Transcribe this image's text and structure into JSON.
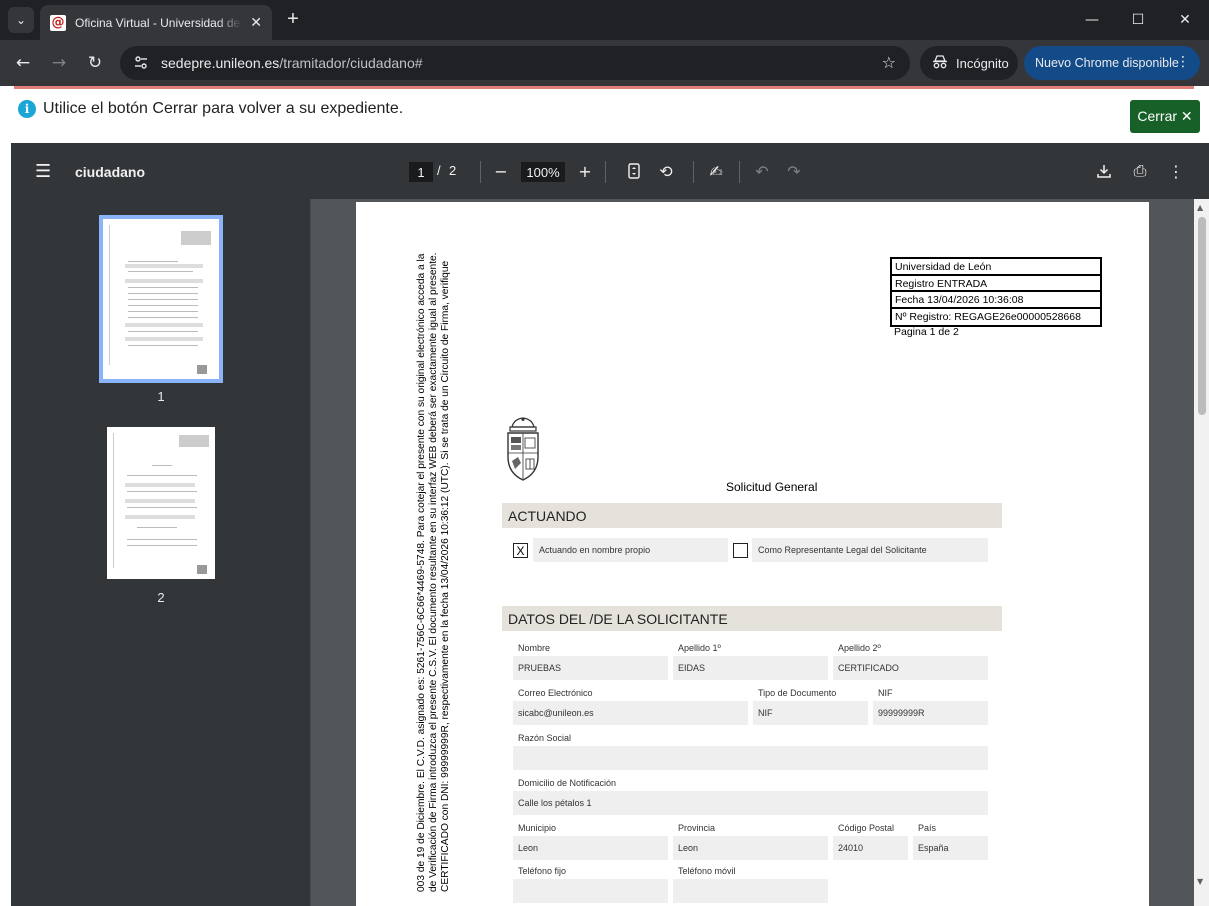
{
  "browser": {
    "tab_title": "Oficina Virtual - Universidad de León",
    "url_domain": "sedepre.unileon.es",
    "url_path": "/tramitador/ciudadano#",
    "incognito_label": "Incógnito",
    "update_label": "Nuevo Chrome disponible"
  },
  "page": {
    "info_message": "Utilice el botón Cerrar para volver a su expediente.",
    "close_button": "Cerrar ✕"
  },
  "viewer": {
    "doc_name": "ciudadano",
    "current_page": "1",
    "page_separator": "/",
    "total_pages": "2",
    "zoom": "100%",
    "thumbnails": [
      {
        "label": "1"
      },
      {
        "label": "2"
      }
    ]
  },
  "pdf": {
    "vertical_text": [
      "Para cotejar el presente con su original electrónico acceda a la",
      "de Verificación de Firma introduzca el presente C.S.V. El documento resultante en su interfaz WEB deberá ser exactamente igual al presente.",
      "CERTIFICADO con DNI: 99999999R, respectivamente en la fecha 13/04/2026 10:36:12 (UTC). Si se trata de un Circuito de Firma, verifique"
    ],
    "vertical_text_lead": "003 de 19 de Diciembre. El C.V.D. asignado es: 5261-756C-6C66*4469-5748. ",
    "registro": {
      "line1": "Universidad de León",
      "line2": "Registro ENTRADA",
      "line3": "Fecha 13/04/2026 10:36:08",
      "line4": "Nº Registro: REGAGE26e00000528668"
    },
    "pagina": "Pagina 1 de 2",
    "form_title": "Solicitud General",
    "section_actuando": "ACTUANDO",
    "opt1_mark": "X",
    "opt1": "Actuando en nombre propio",
    "opt2": "Como Representante Legal del Solicitante",
    "section_datos": "DATOS DEL /DE LA SOLICITANTE",
    "fields": {
      "nombre_label": "Nombre",
      "nombre": "PRUEBAS",
      "ap1_label": "Apellido 1º",
      "ap1": "EIDAS",
      "ap2_label": "Apellido 2º",
      "ap2": "CERTIFICADO",
      "email_label": "Correo Electrónico",
      "email": "sicabc@unileon.es",
      "tipodoc_label": "Tipo de Documento",
      "tipodoc": "NIF",
      "nif_label": "NIF",
      "nif": "99999999R",
      "razon_label": "Razón Social",
      "razon": "",
      "domicilio_label": "Domicilio de Notificación",
      "domicilio": "Calle los pétalos 1",
      "municipio_label": "Municipio",
      "municipio": "Leon",
      "provincia_label": "Provincia",
      "provincia": "Leon",
      "cp_label": "Código Postal",
      "cp": "24010",
      "pais_label": "País",
      "pais": "España",
      "tfijo_label": "Teléfono fijo",
      "tmovil_label": "Teléfono móvil"
    }
  }
}
